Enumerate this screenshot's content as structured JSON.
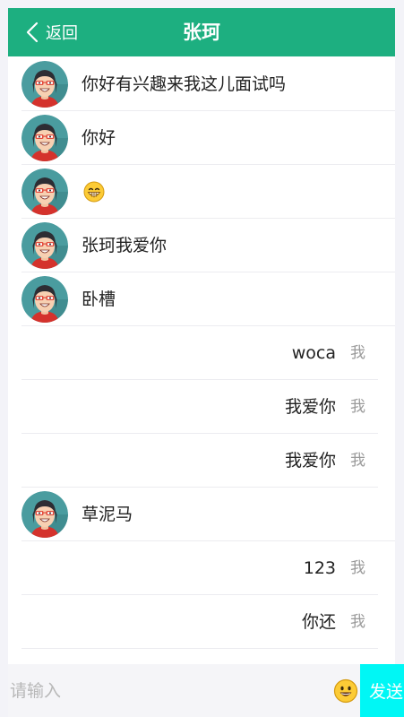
{
  "header": {
    "back_label": "返回",
    "title": "张珂"
  },
  "me_label": "我",
  "messages": [
    {
      "side": "left",
      "text": "你好有兴趣来我这儿面试吗"
    },
    {
      "side": "left",
      "text": "你好"
    },
    {
      "side": "left",
      "emoji": "grinning-face-emoji"
    },
    {
      "side": "left",
      "text": "张珂我爱你"
    },
    {
      "side": "left",
      "text": "卧槽"
    },
    {
      "side": "right",
      "text": "woca"
    },
    {
      "side": "right",
      "text": "我爱你"
    },
    {
      "side": "right",
      "text": "我爱你"
    },
    {
      "side": "left",
      "text": "草泥马"
    },
    {
      "side": "right",
      "text": "123"
    },
    {
      "side": "right",
      "text": "你还"
    }
  ],
  "composer": {
    "placeholder": "请输入",
    "emoji_icon": "smiley-emoji-icon",
    "send_label": "发送"
  },
  "colors": {
    "header": "#1daf80",
    "send_button": "#00f7f5",
    "avatar_bg": "#4a9c9f"
  }
}
